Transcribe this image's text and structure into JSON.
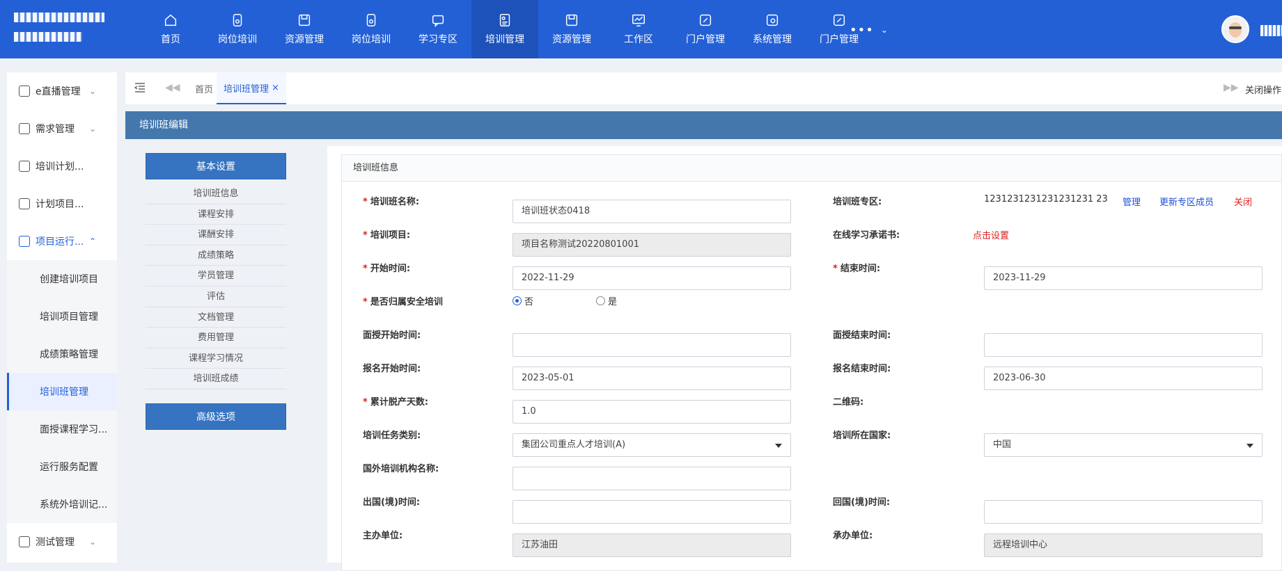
{
  "topnav": {
    "items": [
      {
        "label": "首页",
        "icon": "home-icon"
      },
      {
        "label": "岗位培训",
        "icon": "badge-icon"
      },
      {
        "label": "资源管理",
        "icon": "folder-icon"
      },
      {
        "label": "岗位培训",
        "icon": "badge-icon"
      },
      {
        "label": "学习专区",
        "icon": "chat-icon"
      },
      {
        "label": "培训管理",
        "icon": "training-icon"
      },
      {
        "label": "资源管理",
        "icon": "folder-icon"
      },
      {
        "label": "工作区",
        "icon": "monitor-icon"
      },
      {
        "label": "门户管理",
        "icon": "pen-icon"
      },
      {
        "label": "系统管理",
        "icon": "settings-icon"
      },
      {
        "label": "门户管理",
        "icon": "pen-icon"
      }
    ],
    "more": "•••"
  },
  "sidebar": {
    "items": [
      {
        "label": "e直播管理"
      },
      {
        "label": "需求管理"
      },
      {
        "label": "培训计划..."
      },
      {
        "label": "计划项目..."
      },
      {
        "label": "项目运行..."
      }
    ],
    "sub": [
      {
        "label": "创建培训项目"
      },
      {
        "label": "培训项目管理"
      },
      {
        "label": "成绩策略管理"
      },
      {
        "label": "培训班管理"
      },
      {
        "label": "面授课程学习..."
      },
      {
        "label": "运行服务配置"
      },
      {
        "label": "系统外培训记..."
      }
    ],
    "bottom": {
      "label": "测试管理"
    }
  },
  "tabs": {
    "home": "首页",
    "active": "培训班管理",
    "close": "×",
    "ops": "关闭操作"
  },
  "panel": {
    "title": "培训班编辑"
  },
  "leftnav": {
    "basic_button": "基本设置",
    "links": [
      "培训班信息",
      "课程安排",
      "课酬安排",
      "成绩策略",
      "学员管理",
      "评估",
      "文档管理",
      "费用管理",
      "课程学习情况",
      "培训班成绩"
    ],
    "advanced_button": "高级选项"
  },
  "form": {
    "section_title": "培训班信息",
    "class_name": {
      "label": "培训班名称:",
      "value": "培训班状态0418"
    },
    "zone": {
      "label": "培训班专区:",
      "value": "1231231231231231231 23",
      "manage": "管理",
      "update_members": "更新专区成员",
      "close": "关闭"
    },
    "project": {
      "label": "培训项目:",
      "value": "项目名称测试20220801001"
    },
    "commitment": {
      "label": "在线学习承诺书:",
      "link": "点击设置"
    },
    "start_time": {
      "label": "开始时间:",
      "value": "2022-11-29"
    },
    "end_time": {
      "label": "结束时间:",
      "value": "2023-11-29"
    },
    "safety": {
      "label": "是否归属安全培训",
      "no": "否",
      "yes": "是"
    },
    "f2f_start": {
      "label": "面授开始时间:",
      "value": ""
    },
    "f2f_end": {
      "label": "面授结束时间:",
      "value": ""
    },
    "signup_start": {
      "label": "报名开始时间:",
      "value": "2023-05-01"
    },
    "signup_end": {
      "label": "报名结束时间:",
      "value": "2023-06-30"
    },
    "days_off": {
      "label": "累计脱产天数:",
      "value": "1.0"
    },
    "qrcode": {
      "label": "二维码:"
    },
    "task_type": {
      "label": "培训任务类别:",
      "value": "集团公司重点人才培训(A)"
    },
    "country": {
      "label": "培训所在国家:",
      "value": "中国"
    },
    "foreign_org": {
      "label": "国外培训机构名称:",
      "value": ""
    },
    "depart_time": {
      "label": "出国(境)时间:",
      "value": ""
    },
    "return_time": {
      "label": "回国(境)时间:",
      "value": ""
    },
    "host": {
      "label": "主办单位:",
      "value": "江苏油田"
    },
    "organizer": {
      "label": "承办单位:",
      "value": "远程培训中心"
    }
  },
  "colors": {
    "header": "#2360d6",
    "panel": "#4478ad",
    "button": "#3674c2",
    "danger": "#e02020"
  }
}
